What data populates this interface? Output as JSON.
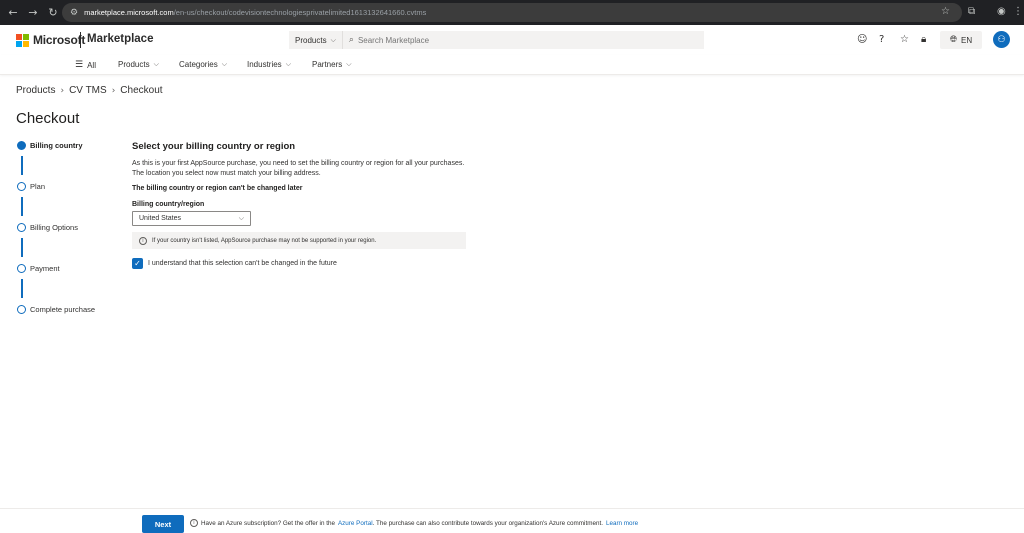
{
  "browser": {
    "url_host": "marketplace.microsoft.com",
    "url_path": "/en-us/checkout/codevisiontechnologiesprivatelimited1613132641660.cvtms"
  },
  "header": {
    "brand": "Microsoft",
    "product": "Marketplace",
    "search_scope": "Products",
    "search_placeholder": "Search Marketplace",
    "language": "EN",
    "logo_colors": [
      "#f25022",
      "#7fba00",
      "#00a4ef",
      "#ffb900"
    ]
  },
  "nav": {
    "all": "All",
    "items": [
      "Products",
      "Categories",
      "Industries",
      "Partners"
    ]
  },
  "breadcrumb": [
    "Products",
    "CV TMS",
    "Checkout"
  ],
  "page_title": "Checkout",
  "steps": [
    {
      "label": "Billing country",
      "active": true
    },
    {
      "label": "Plan",
      "active": false
    },
    {
      "label": "Billing Options",
      "active": false
    },
    {
      "label": "Payment",
      "active": false
    },
    {
      "label": "Complete purchase",
      "active": false
    }
  ],
  "main": {
    "heading": "Select your billing country or region",
    "desc_line1": "As this is your first AppSource purchase, you need to set the billing country or region for all your purchases.",
    "desc_line2": "The location you select now must match your billing address.",
    "warning": "The billing country or region can't be changed later",
    "field_label": "Billing country/region",
    "selected_country": "United States",
    "info_text": "If your country isn't listed, AppSource purchase may not be supported in your region.",
    "checkbox_label": "I understand that this selection can't be changed in the future",
    "checkbox_checked": true
  },
  "footer": {
    "next": "Next",
    "msg_before": "Have an Azure subscription? Get the offer in the",
    "portal_link": "Azure Portal",
    "msg_after": ". The purchase can also contribute towards your organization's Azure commitment.",
    "learn_more": "Learn more"
  },
  "colors": {
    "accent": "#0f6cbd"
  }
}
